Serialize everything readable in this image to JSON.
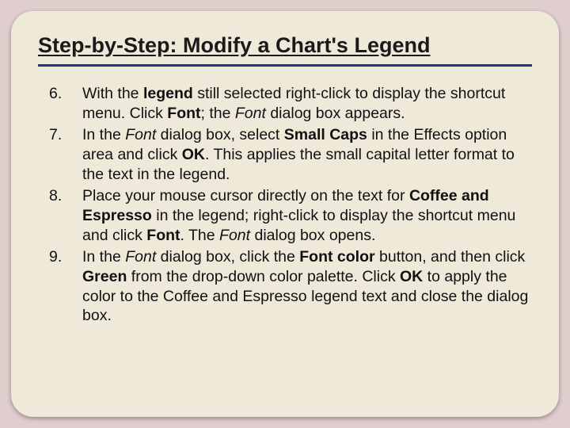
{
  "title": "Step-by-Step: Modify a Chart's Legend",
  "steps": {
    "s6": {
      "t1": "With the ",
      "t2": "legend",
      "t3": " still selected right-click to display the shortcut menu. Click ",
      "t4": "Font",
      "t5": "; the ",
      "t6": "Font",
      "t7": " dialog box appears."
    },
    "s7": {
      "t1": "In the ",
      "t2": "Font",
      "t3": " dialog box, select ",
      "t4": "Small Caps",
      "t5": " in the Effects option area and click ",
      "t6": "OK",
      "t7": ". This applies the small capital letter format to the text in the legend."
    },
    "s8": {
      "t1": "Place your mouse cursor directly on the text for ",
      "t2": "Coffee and Espresso",
      "t3": " in the legend; right-click to display the shortcut menu and click ",
      "t4": "Font",
      "t5": ". The ",
      "t6": "Font",
      "t7": " dialog box opens."
    },
    "s9": {
      "t1": "In the ",
      "t2": "Font",
      "t3": " dialog box, click the ",
      "t4": "Font color",
      "t5": " button, and then click ",
      "t6": "Green",
      "t7": " from the drop-down color palette. Click ",
      "t8": "OK",
      "t9": " to apply the color to the Coffee and Espresso legend text and close the dialog box."
    }
  }
}
